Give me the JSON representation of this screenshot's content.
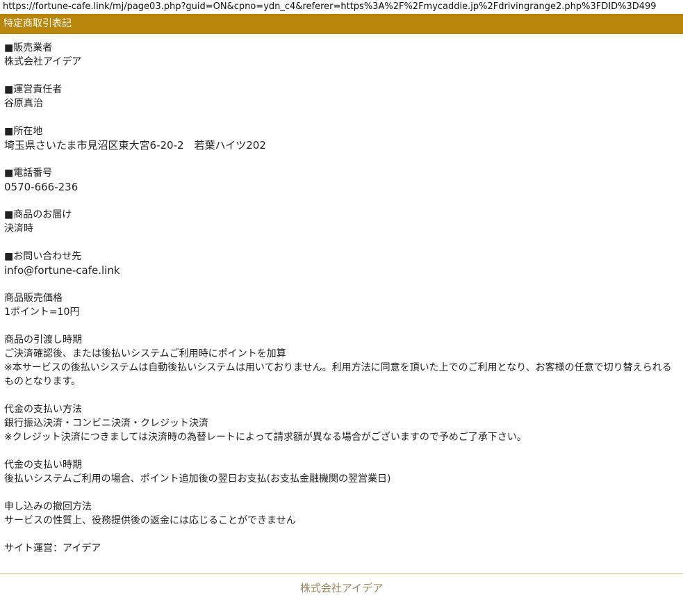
{
  "url": "https://fortune-cafe.link/mj/page03.php?guid=ON&cpno=ydn_c4&referer=https%3A%2F%2Fmycaddie.jp%2Fdrivingrange2.php%3FDID%3D499",
  "title": "特定商取引表記",
  "sections": [
    {
      "heading": "■販売業者",
      "lines": [
        "株式会社アイデア"
      ]
    },
    {
      "heading": "■運営責任者",
      "lines": [
        "谷原真治"
      ]
    },
    {
      "heading": "■所在地",
      "lines": [
        "埼玉県さいたま市見沼区東大宮6-20-2　若葉ハイツ202"
      ]
    },
    {
      "heading": "■電話番号",
      "lines": [
        "0570-666-236"
      ]
    },
    {
      "heading": "■商品のお届け",
      "lines": [
        "決済時"
      ]
    },
    {
      "heading": "■お問い合わせ先",
      "lines": [
        "info@fortune-cafe.link"
      ]
    },
    {
      "heading": "商品販売価格",
      "lines": [
        "1ポイント=10円"
      ]
    },
    {
      "heading": "商品の引渡し時期",
      "lines": [
        "ご決済確認後、または後払いシステムご利用時にポイントを加算",
        "※本サービスの後払いシステムは自動後払いシステムは用いておりません。利用方法に同意を頂いた上でのご利用となり、お客様の任意で切り替えられるものとなります。"
      ]
    },
    {
      "heading": "代金の支払い方法",
      "lines": [
        "銀行振込決済・コンビニ決済・クレジット決済",
        "※クレジット決済につきましては決済時の為替レートによって請求額が異なる場合がございますので予めご了承下さい。"
      ]
    },
    {
      "heading": "代金の支払い時期",
      "lines": [
        "後払いシステムご利用の場合、ポイント追加後の翌日お支払(お支払金融機関の翌営業日)"
      ]
    },
    {
      "heading": "申し込みの撤回方法",
      "lines": [
        "サービスの性質上、役務提供後の返金には応じることができません"
      ]
    },
    {
      "heading": "サイト運営：アイデア",
      "lines": []
    }
  ],
  "footer": "株式会社アイデア"
}
